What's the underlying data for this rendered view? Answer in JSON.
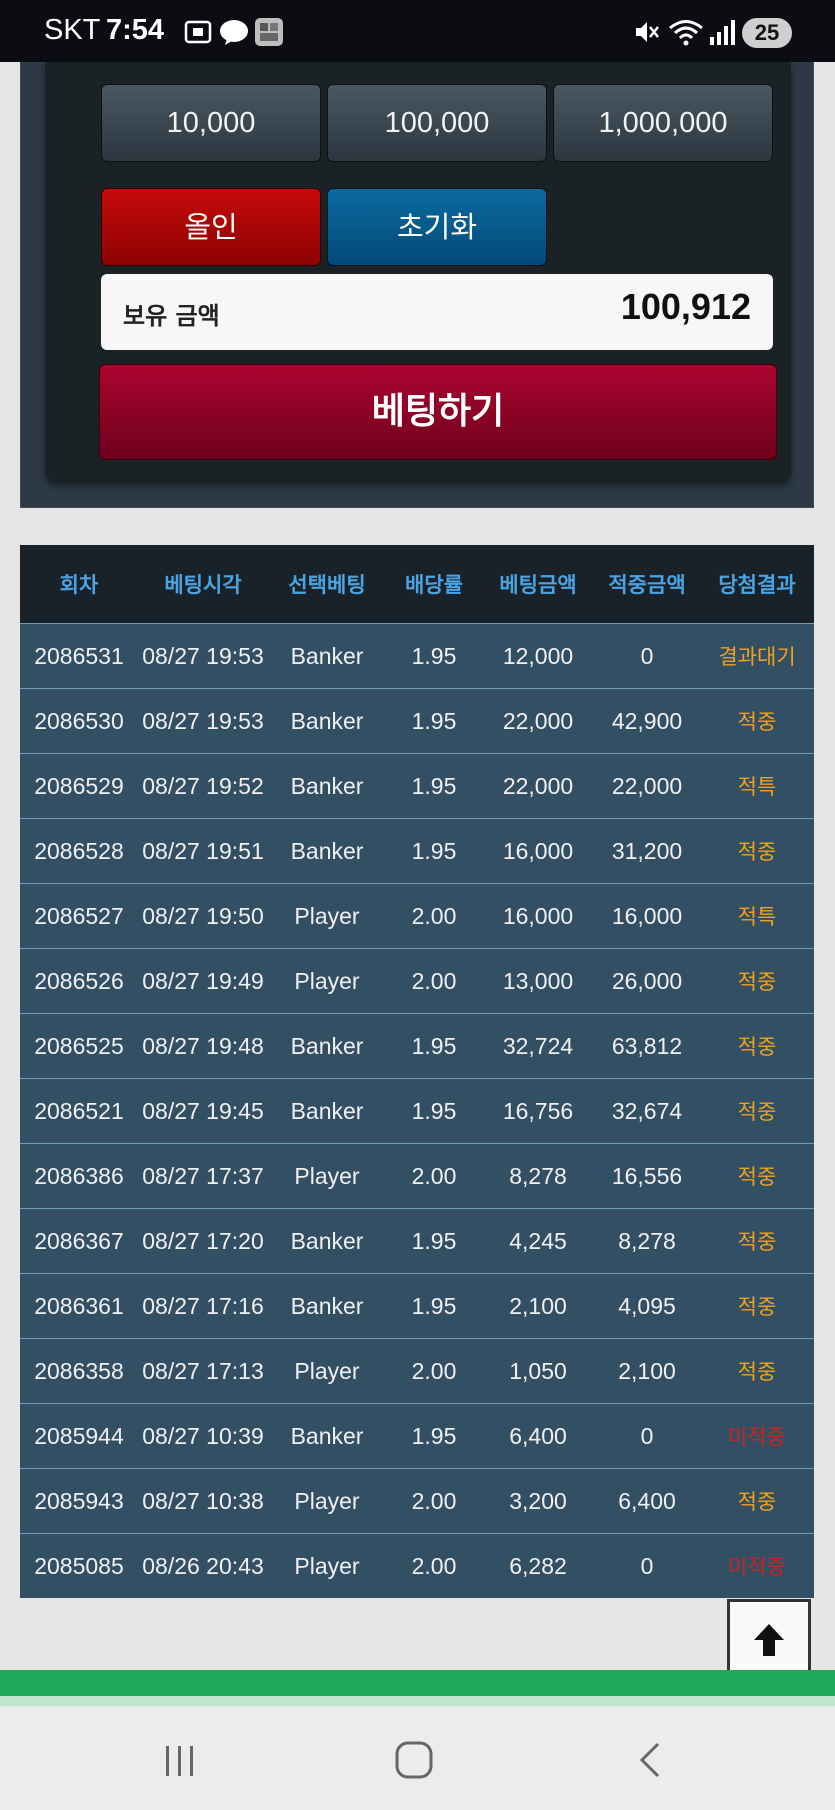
{
  "status_bar": {
    "carrier": "SKT",
    "time": "7:54",
    "battery": "25"
  },
  "bet_panel": {
    "chips": [
      "10,000",
      "100,000",
      "1,000,000"
    ],
    "allin_label": "올인",
    "reset_label": "초기화",
    "balance_label": "보유 금액",
    "balance_value": "100,912",
    "bet_button_label": "베팅하기"
  },
  "history": {
    "headers": [
      "회차",
      "베팅시각",
      "선택베팅",
      "배당률",
      "베팅금액",
      "적중금액",
      "당첨결과"
    ],
    "rows": [
      {
        "round": "2086531",
        "time": "08/27 19:53",
        "pick": "Banker",
        "odds": "1.95",
        "bet": "12,000",
        "win": "0",
        "result": "결과대기",
        "status": "wait"
      },
      {
        "round": "2086530",
        "time": "08/27 19:53",
        "pick": "Banker",
        "odds": "1.95",
        "bet": "22,000",
        "win": "42,900",
        "result": "적중",
        "status": "hit"
      },
      {
        "round": "2086529",
        "time": "08/27 19:52",
        "pick": "Banker",
        "odds": "1.95",
        "bet": "22,000",
        "win": "22,000",
        "result": "적특",
        "status": "hit"
      },
      {
        "round": "2086528",
        "time": "08/27 19:51",
        "pick": "Banker",
        "odds": "1.95",
        "bet": "16,000",
        "win": "31,200",
        "result": "적중",
        "status": "hit"
      },
      {
        "round": "2086527",
        "time": "08/27 19:50",
        "pick": "Player",
        "odds": "2.00",
        "bet": "16,000",
        "win": "16,000",
        "result": "적특",
        "status": "hit"
      },
      {
        "round": "2086526",
        "time": "08/27 19:49",
        "pick": "Player",
        "odds": "2.00",
        "bet": "13,000",
        "win": "26,000",
        "result": "적중",
        "status": "hit"
      },
      {
        "round": "2086525",
        "time": "08/27 19:48",
        "pick": "Banker",
        "odds": "1.95",
        "bet": "32,724",
        "win": "63,812",
        "result": "적중",
        "status": "hit"
      },
      {
        "round": "2086521",
        "time": "08/27 19:45",
        "pick": "Banker",
        "odds": "1.95",
        "bet": "16,756",
        "win": "32,674",
        "result": "적중",
        "status": "hit"
      },
      {
        "round": "2086386",
        "time": "08/27 17:37",
        "pick": "Player",
        "odds": "2.00",
        "bet": "8,278",
        "win": "16,556",
        "result": "적중",
        "status": "hit"
      },
      {
        "round": "2086367",
        "time": "08/27 17:20",
        "pick": "Banker",
        "odds": "1.95",
        "bet": "4,245",
        "win": "8,278",
        "result": "적중",
        "status": "hit"
      },
      {
        "round": "2086361",
        "time": "08/27 17:16",
        "pick": "Banker",
        "odds": "1.95",
        "bet": "2,100",
        "win": "4,095",
        "result": "적중",
        "status": "hit"
      },
      {
        "round": "2086358",
        "time": "08/27 17:13",
        "pick": "Player",
        "odds": "2.00",
        "bet": "1,050",
        "win": "2,100",
        "result": "적중",
        "status": "hit"
      },
      {
        "round": "2085944",
        "time": "08/27 10:39",
        "pick": "Banker",
        "odds": "1.95",
        "bet": "6,400",
        "win": "0",
        "result": "미적중",
        "status": "miss"
      },
      {
        "round": "2085943",
        "time": "08/27 10:38",
        "pick": "Player",
        "odds": "2.00",
        "bet": "3,200",
        "win": "6,400",
        "result": "적중",
        "status": "hit"
      },
      {
        "round": "2085085",
        "time": "08/26 20:43",
        "pick": "Player",
        "odds": "2.00",
        "bet": "6,282",
        "win": "0",
        "result": "미적중",
        "status": "miss"
      }
    ]
  },
  "colors": {
    "result_pending": "#f0a21c",
    "result_hit": "#f0a21c",
    "result_miss": "#cc2222",
    "header_text": "#4aa3e2",
    "footer_green": "#1ea95a"
  },
  "icons": {
    "scroll_top": "arrow-up-icon",
    "nav_recent": "recent-apps-icon",
    "nav_home": "home-icon",
    "nav_back": "back-icon"
  }
}
